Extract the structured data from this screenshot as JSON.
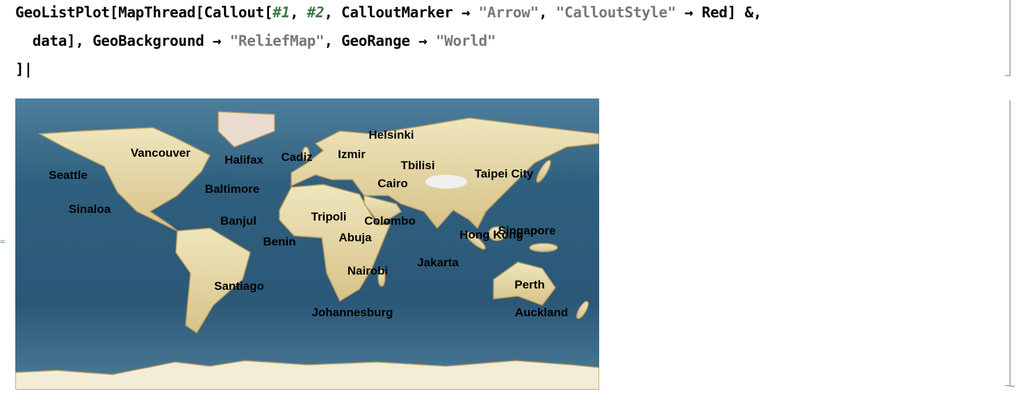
{
  "code": {
    "line1_a": "GeoListPlot[MapThread[Callout[",
    "slot1": "#1",
    "sep": ", ",
    "slot2": "#2",
    "line1_b": ", CalloutMarker → ",
    "arrow_str": "\"Arrow\"",
    "line1_c": ", ",
    "style_str": "\"CalloutStyle\"",
    "line1_d": " → Red] &,",
    "line2_a": "  data], GeoBackground → ",
    "relief_str": "\"ReliefMap\"",
    "line2_b": ", GeoRange → ",
    "world_str": "\"World\"",
    "line3": "]|"
  },
  "output_marker": "=",
  "map": {
    "background": "ReliefMap",
    "range": "World",
    "colors": {
      "ocean": "#2f5f7e",
      "land": "#e2d49c",
      "label": "#000000"
    },
    "labels": [
      "Seattle",
      "Vancouver",
      "Halifax",
      "Cadiz",
      "Izmir",
      "Helsinki",
      "Tbilisi",
      "Taipei City",
      "Cairo",
      "Baltimore",
      "Sinaloa",
      "Banjul",
      "Tripoli",
      "Colombo",
      "Hong Kong",
      "Singapore",
      "Abuja",
      "Benin",
      "Jakarta",
      "Nairobi",
      "Perth",
      "Santiago",
      "Johannesburg",
      "Auckland"
    ]
  }
}
